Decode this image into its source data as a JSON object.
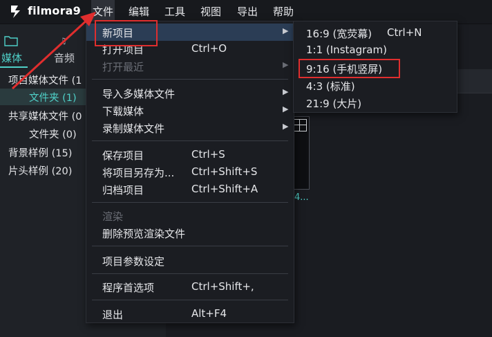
{
  "app": {
    "name": "filmora9"
  },
  "menubar": {
    "items": [
      "文件",
      "编辑",
      "工具",
      "视图",
      "导出",
      "帮助"
    ]
  },
  "media_panel": {
    "tabs": [
      "媒体",
      "音频"
    ],
    "tree": [
      {
        "label": "项目媒体文件 (1",
        "level": 0
      },
      {
        "label": "文件夹 (1)",
        "level": 1,
        "selected": true
      },
      {
        "label": "共享媒体文件 (0",
        "level": 0
      },
      {
        "label": "文件夹 (0)",
        "level": 1
      },
      {
        "label": "背景样例 (15)",
        "level": 0
      },
      {
        "label": "片头样例 (20)",
        "level": 0
      }
    ],
    "thumbnail_label": "4..."
  },
  "file_menu": {
    "items": [
      {
        "label": "新项目",
        "shortcut": "",
        "submenu": true,
        "highlighted": true
      },
      {
        "label": "打开项目",
        "shortcut": "Ctrl+O"
      },
      {
        "label": "打开最近",
        "shortcut": "",
        "submenu": true,
        "disabled": true
      },
      {
        "label": "导入多媒体文件",
        "shortcut": "",
        "submenu": true
      },
      {
        "label": "下载媒体",
        "shortcut": "",
        "submenu": true
      },
      {
        "label": "录制媒体文件",
        "shortcut": "",
        "submenu": true
      },
      {
        "label": "保存项目",
        "shortcut": "Ctrl+S"
      },
      {
        "label": "将项目另存为...",
        "shortcut": "Ctrl+Shift+S"
      },
      {
        "label": "归档项目",
        "shortcut": "Ctrl+Shift+A"
      },
      {
        "label": "渲染",
        "shortcut": "",
        "disabled": true
      },
      {
        "label": "删除预览渲染文件",
        "shortcut": ""
      },
      {
        "label": "项目参数设定",
        "shortcut": ""
      },
      {
        "label": "程序首选项",
        "shortcut": "Ctrl+Shift+,"
      },
      {
        "label": "退出",
        "shortcut": "Alt+F4"
      }
    ]
  },
  "new_project_submenu": {
    "items": [
      {
        "label": "16:9 (宽荧幕)",
        "shortcut": "Ctrl+N"
      },
      {
        "label": "1:1 (Instagram)",
        "shortcut": ""
      },
      {
        "label": "9:16 (手机竖屏)",
        "shortcut": "",
        "boxed": true
      },
      {
        "label": "4:3 (标准)",
        "shortcut": ""
      },
      {
        "label": "21:9 (大片)",
        "shortcut": ""
      }
    ]
  },
  "colors": {
    "accent": "#4fd0c8",
    "highlight": "#2b3d55",
    "annotation": "#e02e2e"
  },
  "icons": [
    "filmora-logo-icon",
    "folder-icon",
    "audio-icon",
    "submenu-arrow-icon",
    "grid-icon"
  ]
}
